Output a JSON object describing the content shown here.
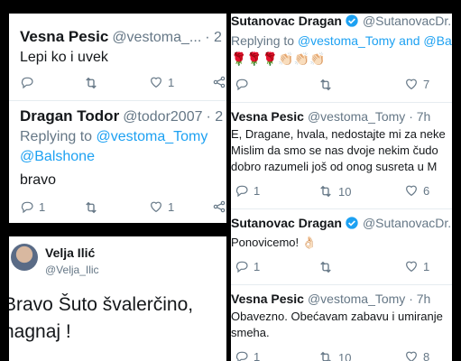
{
  "left_top": {
    "tweet1": {
      "name": "Vesna Pesic",
      "handle": "@vestoma_...",
      "time": "· 2",
      "body": "Lepi ko i uvek",
      "likes": "1"
    },
    "tweet2": {
      "name": "Dragan Todor",
      "handle": "@todor2007",
      "time": "· 2",
      "reply_prefix": "Replying to",
      "reply_mention1": "@vestoma_Tomy",
      "reply_mention2": "@Balshone",
      "body": "bravo",
      "replies": "1",
      "likes": "1"
    }
  },
  "left_bottom": {
    "name": "Velja Ilić",
    "handle": "@Velja_Ilic",
    "body_line1": "Bravo Šuto švalerčino,",
    "body_line2": "nagnaj !"
  },
  "right": {
    "tweet1": {
      "name": "Sutanovac Dragan",
      "handle": "@SutanovacDr...",
      "reply_prefix": "Replying to",
      "reply_mention": "@vestoma_Tomy and @Balsh",
      "emoji": "🌹🌹🌹👏🏻👏🏻👏🏻",
      "likes": "7"
    },
    "tweet2": {
      "name": "Vesna Pesic",
      "handle": "@vestoma_Tomy · 7h",
      "line1": "E, Dragane,  hvala, nedostajte mi za neke",
      "line2": "Mislim da smo se nas dvoje nekim čudo",
      "line3": "dobro razumeli još od onog susreta u M",
      "replies": "1",
      "retweets": "10",
      "likes": "6"
    },
    "tweet3": {
      "name": "Sutanovac Dragan",
      "handle": "@SutanovacDr...",
      "body": "Ponovicemo! 👌🏻",
      "replies": "1",
      "likes": "1"
    },
    "tweet4": {
      "name": "Vesna Pesic",
      "handle": "@vestoma_Tomy · 7h",
      "line1": "Obavezno. Obećavam zabavu i umiranje",
      "line2": "smeha.",
      "replies": "1",
      "retweets": "10",
      "likes": "8"
    }
  },
  "colors": {
    "link": "#1da1f2",
    "muted": "#657786",
    "text": "#14171a"
  }
}
